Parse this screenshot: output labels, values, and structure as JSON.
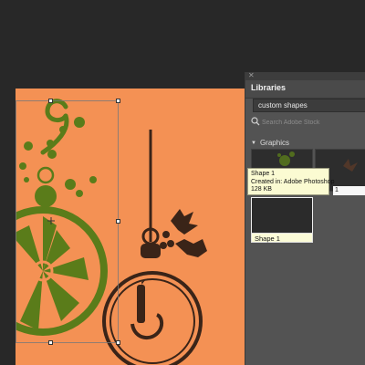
{
  "panel": {
    "title": "Libraries",
    "library_select": "custom shapes",
    "search_placeholder": "Search Adobe Stock",
    "section": "Graphics",
    "items": [
      {
        "label": "Shape 1"
      },
      {
        "label": "1"
      },
      {
        "label": "Shape 1"
      }
    ]
  },
  "tooltip": {
    "name": "Shape 1",
    "created": "Created in: Adobe Photoshop",
    "size": "128 KB"
  },
  "colors": {
    "artboard": "#f49154",
    "ornament_green": "#5a7c1a",
    "ornament_dark": "#3a2418"
  }
}
